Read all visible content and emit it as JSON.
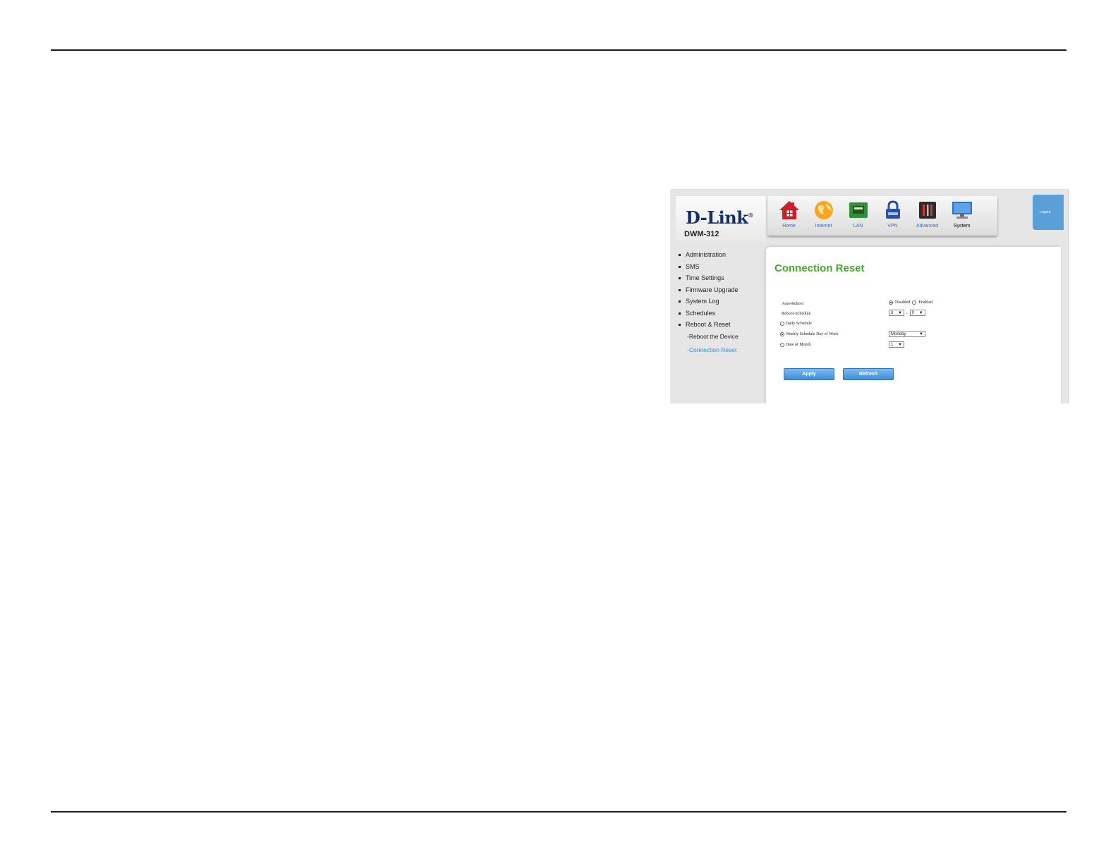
{
  "brand": {
    "logo": "D-Link",
    "model": "DWM-312"
  },
  "nav": [
    {
      "label": "Home",
      "icon": "home-icon"
    },
    {
      "label": "Internet",
      "icon": "globe-icon"
    },
    {
      "label": "LAN",
      "icon": "lan-port-icon"
    },
    {
      "label": "VPN",
      "icon": "lock-icon"
    },
    {
      "label": "Advanced",
      "icon": "tools-icon"
    },
    {
      "label": "System",
      "icon": "monitor-icon",
      "active": true
    }
  ],
  "logout_label": "Logout",
  "sidebar": {
    "items": [
      "Administration",
      "SMS",
      "Time Settings",
      "Firmware Upgrade",
      "System Log",
      "Schedules",
      "Reboot & Reset"
    ],
    "sub_items": [
      "-Reboot the Device",
      "-Connection Reset"
    ]
  },
  "page": {
    "title": "Connection Reset",
    "auto_reboot": {
      "label": "Auto-Reboot",
      "opt_disabled": "Disabled",
      "opt_enabled": "Enabled",
      "selected": "Disabled"
    },
    "reboot_schedule": {
      "label": "Reboot-Schedule",
      "hour": "3",
      "sep": ":",
      "minute": "0"
    },
    "daily": {
      "label": "Daily Schedule"
    },
    "weekly": {
      "label": "Weekly Schedule Day of Week",
      "value": "Monday"
    },
    "monthly": {
      "label": "Date of Month",
      "value": "1"
    },
    "apply_label": "Apply",
    "refresh_label": "Refresh"
  },
  "colors": {
    "title_green": "#3fae2a",
    "link_blue": "#2a8fd6",
    "button_blue": "#3e8dd8"
  }
}
